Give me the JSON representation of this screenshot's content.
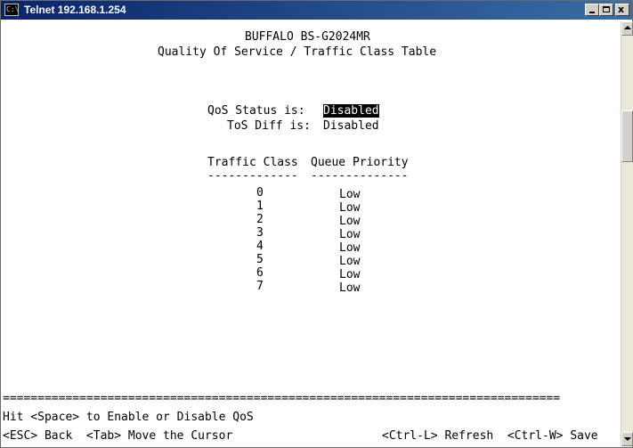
{
  "window": {
    "title": "Telnet 192.168.1.254",
    "icon_label": "C:\\",
    "controls": {
      "minimize": "minimize-icon",
      "maximize": "maximize-icon",
      "close_glyph": "x"
    }
  },
  "screen": {
    "device_name": "BUFFALO BS-G2024MR",
    "page_title": "Quality Of Service / Traffic Class Table",
    "qos_status_label": "QoS Status is:",
    "qos_status_value": "Disabled",
    "tos_diff_label": "ToS Diff is:",
    "tos_diff_value": "Disabled",
    "table": {
      "header_class": "Traffic Class",
      "header_priority": "Queue Priority",
      "underline_class": "-------------",
      "underline_priority": "--------------",
      "rows": [
        {
          "traffic_class": "0",
          "queue_priority": "Low"
        },
        {
          "traffic_class": "1",
          "queue_priority": "Low"
        },
        {
          "traffic_class": "2",
          "queue_priority": "Low"
        },
        {
          "traffic_class": "3",
          "queue_priority": "Low"
        },
        {
          "traffic_class": "4",
          "queue_priority": "Low"
        },
        {
          "traffic_class": "5",
          "queue_priority": "Low"
        },
        {
          "traffic_class": "6",
          "queue_priority": "Low"
        },
        {
          "traffic_class": "7",
          "queue_priority": "Low"
        }
      ]
    },
    "separator": "================================================================================",
    "hint": "Hit <Space> to Enable or Disable QoS",
    "footer_left": "<ESC> Back  <Tab> Move the Cursor",
    "footer_right": "<Ctrl-L> Refresh  <Ctrl-W> Save"
  },
  "colors": {
    "titlebar_start": "#0a246a",
    "titlebar_end": "#3a6ea5",
    "highlight_bg": "#000000",
    "highlight_fg": "#ffffff"
  }
}
